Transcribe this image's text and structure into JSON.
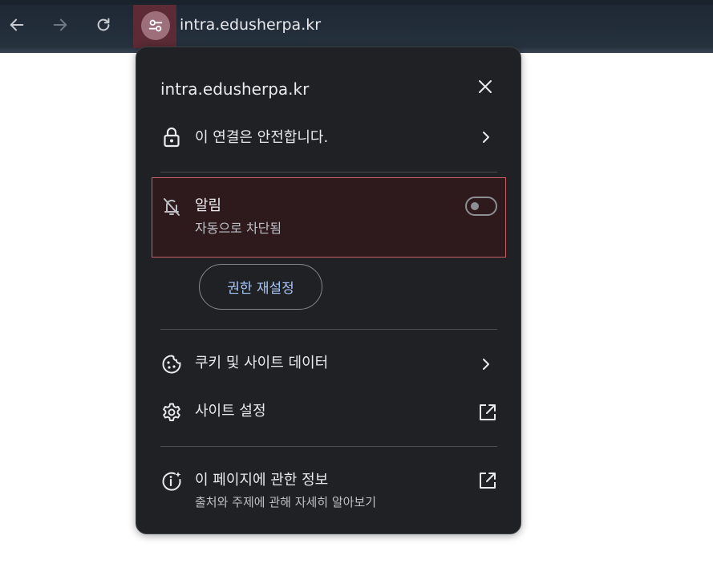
{
  "browser": {
    "url": "intra.edusherpa.kr",
    "colors": {
      "toolbar": "#26313e",
      "site_info_highlight": "#5c2b35"
    }
  },
  "popup": {
    "title": "intra.edusherpa.kr",
    "connection": {
      "label": "이 연결은 안전합니다.",
      "icon": "lock-icon"
    },
    "notifications": {
      "label": "알림",
      "status": "자동으로 차단됨",
      "icon": "bell-off-icon",
      "toggle_on": false
    },
    "reset_permissions": "권한 재설정",
    "cookies": {
      "label": "쿠키 및 사이트 데이터",
      "icon": "cookie-icon"
    },
    "site_settings": {
      "label": "사이트 설정",
      "icon": "gear-icon"
    },
    "page_info": {
      "label": "이 페이지에 관한 정보",
      "sub": "출처와 주제에 관해 자세히 알아보기",
      "icon": "info-sparkle-icon"
    },
    "colors": {
      "background": "#202124",
      "highlight_border": "#c96068",
      "link": "#a8c7fa"
    }
  }
}
